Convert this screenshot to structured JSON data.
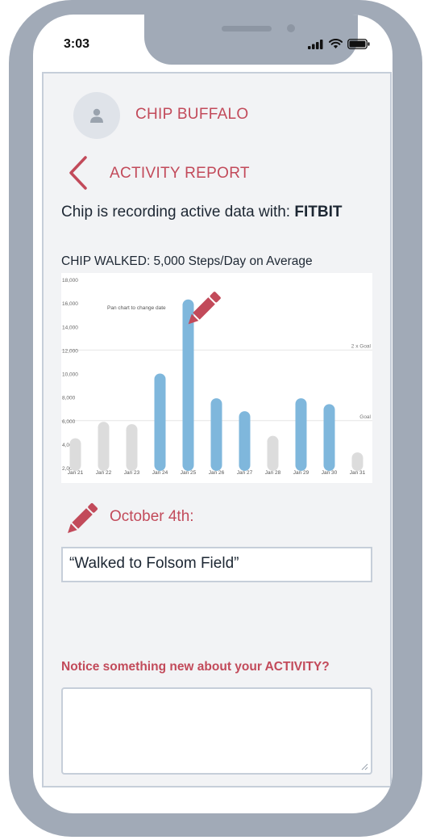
{
  "status_bar": {
    "time": "3:03"
  },
  "user": {
    "name": "CHIP BUFFALO"
  },
  "header": {
    "title": "ACTIVITY REPORT"
  },
  "recording": {
    "prefix": "Chip is recording active data with: ",
    "device": "FITBIT"
  },
  "chart_caption": "CHIP WALKED: 5,000 Steps/Day on Average",
  "chart_data": {
    "type": "bar",
    "categories": [
      "Jan 21",
      "Jan 22",
      "Jan 23",
      "Jan 24",
      "Jan 25",
      "Jan 26",
      "Jan 27",
      "Jan 28",
      "Jan 29",
      "Jan 30",
      "Jan 31"
    ],
    "values": [
      4500,
      5900,
      5700,
      10000,
      16300,
      7900,
      6800,
      4700,
      7900,
      7400,
      3300
    ],
    "highlight": [
      false,
      false,
      false,
      true,
      true,
      true,
      true,
      false,
      true,
      true,
      false
    ],
    "colors": {
      "highlight": "#7fb7dc",
      "normal": "#dcdcdc"
    },
    "ylim": [
      2000,
      18000
    ],
    "yticks": [
      2000,
      4000,
      6000,
      8000,
      10000,
      12000,
      14000,
      16000,
      18000
    ],
    "ytick_labels": [
      "2,000",
      "4,000",
      "6,000",
      "8,000",
      "10,000",
      "12,000",
      "14,000",
      "16,000",
      "18,000"
    ],
    "reference_lines": [
      {
        "label": "Goal",
        "value": 6000
      },
      {
        "label": "2 x Goal",
        "value": 12000
      }
    ],
    "annotation": "Pan chart to change date",
    "grid": false
  },
  "note": {
    "date": "October 4th:",
    "text": "“Walked to Folsom Field”"
  },
  "question": {
    "label": "Notice something new about your ACTIVITY?"
  },
  "icons": {
    "avatar": "person-icon",
    "back": "chevron-left-icon",
    "edit": "pencil-icon",
    "signal": "signal-icon",
    "wifi": "wifi-icon",
    "battery": "battery-icon"
  },
  "colors": {
    "accent": "#c24a5a",
    "frame": "#a1aab7",
    "panel": "#f2f3f5",
    "text": "#1d2733"
  }
}
